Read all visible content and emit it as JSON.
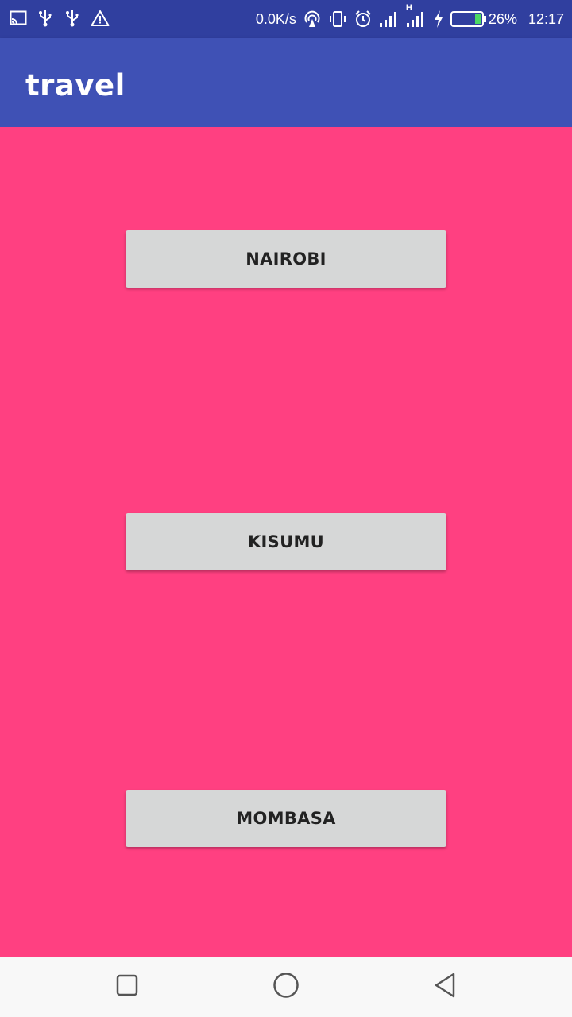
{
  "status_bar": {
    "speed": "0.0K/s",
    "battery": "26%",
    "time": "12:17",
    "network_type": "H",
    "icons": [
      "screen-cast-icon",
      "usb-icon",
      "usb-icon",
      "warning-icon",
      "hotspot-icon",
      "vibrate-icon",
      "alarm-icon",
      "signal-icon",
      "signal-icon",
      "charging-icon",
      "battery-icon"
    ]
  },
  "app_bar": {
    "title": "travel"
  },
  "buttons": [
    {
      "label": "NAIROBI"
    },
    {
      "label": "KISUMU"
    },
    {
      "label": "MOMBASA"
    }
  ],
  "nav_bar": {
    "icons": [
      "recents-icon",
      "home-icon",
      "back-icon"
    ]
  },
  "colors": {
    "status_bar": "#303f9f",
    "app_bar": "#3f51b5",
    "background": "#ff4081",
    "button": "#d6d7d7",
    "battery_fill": "#4cd964"
  }
}
